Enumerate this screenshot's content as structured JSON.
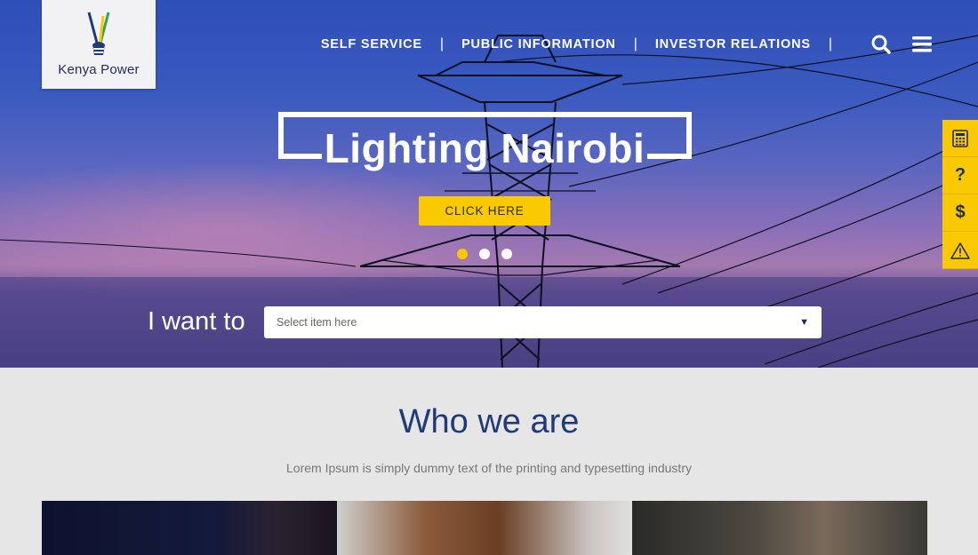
{
  "brand": {
    "name": "Kenya Power"
  },
  "nav": {
    "items": [
      "SELF SERVICE",
      "PUBLIC INFORMATION",
      "INVESTOR RELATIONS"
    ],
    "icons": [
      "search-icon",
      "menu-icon"
    ]
  },
  "hero": {
    "headline": "Lighting Nairobi",
    "cta_label": "CLICK HERE",
    "slides_total": 3,
    "slide_active": 1
  },
  "i_want_to": {
    "label": "I want to",
    "placeholder": "Select item here"
  },
  "side_tools": [
    "calculator-icon",
    "help-icon",
    "dollar-icon",
    "warning-icon"
  ],
  "who": {
    "title": "Who we are",
    "subtitle": "Lorem Ipsum is simply dummy text of the printing and typesetting industry"
  },
  "colors": {
    "accent": "#fbc900",
    "brand_navy": "#1f2b5c",
    "heading_blue": "#1f3a7a"
  }
}
